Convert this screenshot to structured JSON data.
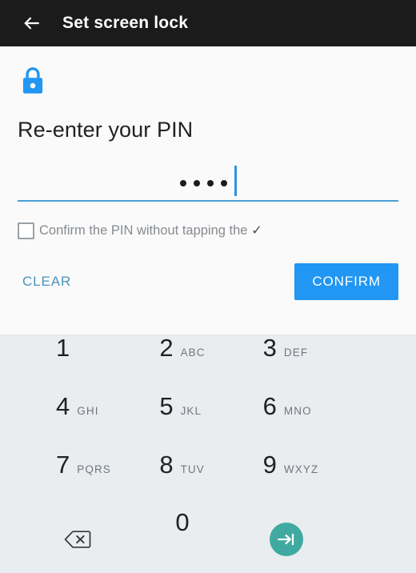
{
  "appbar": {
    "back_icon": "arrow-left-icon",
    "title": "Set screen lock"
  },
  "content": {
    "lock_icon": "lock-closed-icon",
    "lock_color": "#2196f3",
    "headline": "Re-enter your PIN",
    "pin": {
      "entered_digits": 4,
      "masked_value": "••••",
      "caret_color": "#2f92d6",
      "underline_color": "#4a9ed4"
    },
    "checkbox": {
      "checked": false,
      "label_prefix": "Confirm the PIN without tapping the ",
      "label_tick": "✓"
    },
    "clear_label": "CLEAR",
    "confirm_label": "CONFIRM",
    "confirm_color": "#2196f3",
    "clear_color": "#4b93bd"
  },
  "keypad": {
    "background": "#e9edf0",
    "keys": [
      {
        "digit": "1",
        "letters": ""
      },
      {
        "digit": "2",
        "letters": "ABC"
      },
      {
        "digit": "3",
        "letters": "DEF"
      },
      {
        "digit": "4",
        "letters": "GHI"
      },
      {
        "digit": "5",
        "letters": "JKL"
      },
      {
        "digit": "6",
        "letters": "MNO"
      },
      {
        "digit": "7",
        "letters": "PQRS"
      },
      {
        "digit": "8",
        "letters": "TUV"
      },
      {
        "digit": "9",
        "letters": "WXYZ"
      }
    ],
    "backspace_icon": "backspace-icon",
    "zero": {
      "digit": "0",
      "letters": ""
    },
    "enter_icon": "enter-arrow-icon",
    "enter_color": "#40aaa0"
  }
}
